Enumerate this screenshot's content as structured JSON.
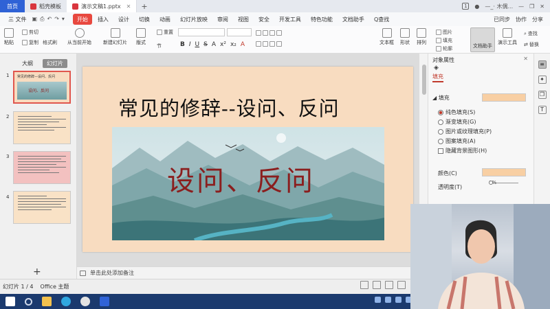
{
  "titlebar": {
    "home_tab": "首页",
    "tabs": [
      {
        "label": "稻壳模板"
      },
      {
        "label": "演示文稿1.pptx"
      }
    ],
    "new_tab": "+",
    "account": "—_· 木偶...",
    "window_controls": [
      "—",
      "❐",
      "✕"
    ]
  },
  "menubar": {
    "file": "三 文件",
    "items": [
      "开始",
      "插入",
      "设计",
      "切换",
      "动画",
      "幻灯片放映",
      "审阅",
      "视图",
      "安全",
      "开发工具",
      "特色功能",
      "文档助手"
    ],
    "active": "开始",
    "search": "Q查找",
    "right": [
      "已同步",
      "协作",
      "分享"
    ]
  },
  "ribbon": {
    "paste": "粘贴",
    "cut": "剪切",
    "copy": "复制",
    "format_painter": "格式刷",
    "from_current": "从当前开始",
    "new_slide": "新建幻灯片",
    "layout": "版式",
    "section": "节",
    "reset": "重置",
    "textbox": "文本框",
    "shape": "形状",
    "arrange": "排列",
    "picture": "图片",
    "fill": "填充",
    "outline": "轮廓",
    "doc_helper": "文档助手",
    "slide_master": "演示工具",
    "find": "查找",
    "replace": "替换",
    "format_row": [
      "B",
      "I",
      "U",
      "S",
      "A",
      "x²",
      "x₂",
      "A"
    ]
  },
  "left_panel": {
    "tabs": [
      "大纲",
      "幻灯片"
    ],
    "active_tab": "幻灯片",
    "slide_numbers": [
      "1",
      "2",
      "3",
      "4"
    ],
    "thumb1_title": "常见的修辞—设问、反问",
    "thumb1_sub": "设问、反问",
    "add": "+"
  },
  "slide": {
    "title": "常见的修辞--设问、反问",
    "picture_text": "设问、反问"
  },
  "notes": {
    "placeholder": "单击此处添加备注"
  },
  "right_panel": {
    "title": "对象属性",
    "close": "✕",
    "tab": "填充",
    "section": "◢ 填充",
    "fill_options": [
      {
        "label": "纯色填充(S)",
        "selected": true
      },
      {
        "label": "渐变填充(G)",
        "selected": false
      },
      {
        "label": "图片或纹理填充(P)",
        "selected": false
      },
      {
        "label": "图案填充(A)",
        "selected": false
      }
    ],
    "hide_bg": "隐藏背景图形(H)",
    "color_label": "颜色(C)",
    "transparency_label": "透明度(T)",
    "transparency_value": "0%",
    "fill_color": "#f8cfa3"
  },
  "statusbar": {
    "slide_count": "幻灯片 1 / 4",
    "theme": "Office 主题"
  },
  "colors": {
    "accent": "#e8483f",
    "slide_bg": "#f8dcc0",
    "taskbar": "#1b3a6e",
    "home_tab": "#2f62d6"
  }
}
